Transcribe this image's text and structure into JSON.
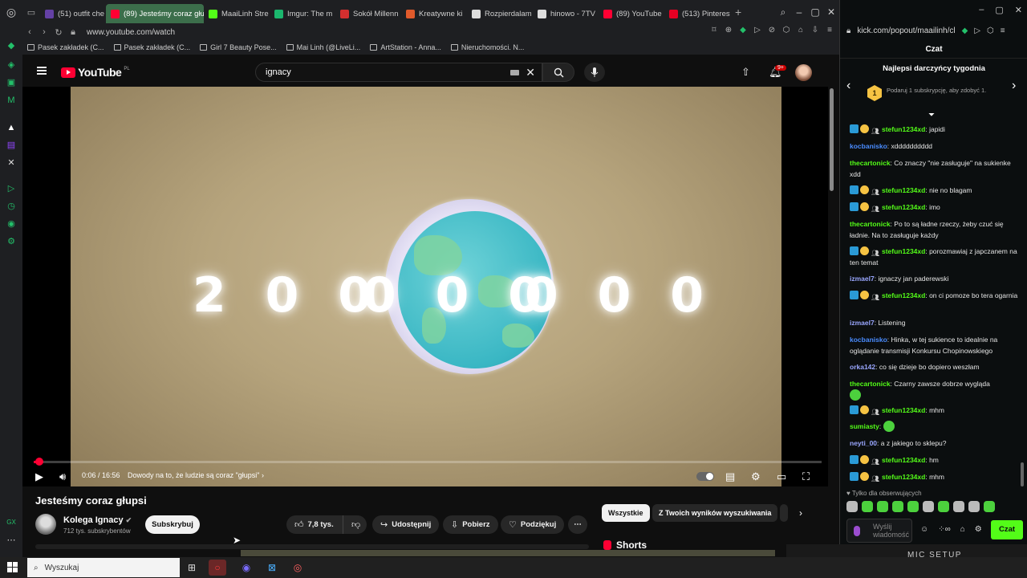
{
  "browser": {
    "tabs": [
      {
        "label": "(51) outfit che",
        "fav_color": "#6441a5"
      },
      {
        "label": "(89) Jesteśmy coraz głu",
        "fav_color": "#ff0033",
        "active": true
      },
      {
        "label": "MaaiLinh Stre",
        "fav_color": "#53fc18"
      },
      {
        "label": "Imgur: The m",
        "fav_color": "#1bb76e"
      },
      {
        "label": "Sokół Millenn",
        "fav_color": "#d32f2f"
      },
      {
        "label": "Kreatywne ki",
        "fav_color": "#e05a2b"
      },
      {
        "label": "Rozpierdalam",
        "fav_color": "#dddddd"
      },
      {
        "label": "hinowo - 7TV",
        "fav_color": "#dddddd"
      },
      {
        "label": "(89) YouTube",
        "fav_color": "#ff0033"
      },
      {
        "label": "(513) Pinterest",
        "fav_color": "#e60023"
      }
    ],
    "url": "www.youtube.com/watch",
    "bookmarks": [
      "Pasek zakładek (C...",
      "Pasek zakładek (C...",
      "Girl 7 Beauty Pose...",
      "Mai Linh (@LiveLi...",
      "ArtStation - Anna...",
      "Nieruchomości. N..."
    ]
  },
  "youtube": {
    "logo_text": "YouTube",
    "region": "PL",
    "search_value": "ignacy",
    "notif_count": "9+",
    "video": {
      "overlay_number": "200000000",
      "overlay_left": "2 0 0",
      "overlay_mid": "0 0 0",
      "overlay_right": "0 0 0",
      "progress": 0.006,
      "time": "0:06 / 16:56",
      "chapter": "Dowody na to, że ludzie są coraz \"głupsi\"  ›"
    },
    "title": "Jesteśmy coraz głupsi",
    "channel": {
      "name": "Kolega Ignacy",
      "subs": "712 tys. subskrybentów",
      "subscribe": "Subskrybuj"
    },
    "actions": {
      "likes": "7,8 tys.",
      "share": "Udostępnij",
      "download": "Pobierz",
      "thanks": "Podziękuj",
      "more": "⋯"
    },
    "chips": [
      "Wszystkie",
      "Z Twoich wyników wyszukiwania"
    ],
    "shorts": "Shorts"
  },
  "kick": {
    "url": "kick.com/popout/maailinh/cl",
    "title": "Czat",
    "top_title": "Najlepsi darczyńcy tygodnia",
    "gift_badge": "1",
    "gift_text": "Podaruj 1 subskrypcję, aby zdobyć 1.",
    "messages": [
      {
        "user": "stefun1234xd",
        "color": "#53fc18",
        "text": "japidi",
        "badges": true
      },
      {
        "user": "kocbanisko",
        "color": "#4a8cff",
        "text": "xdddddddddd",
        "badges": false
      },
      {
        "user": "thecartonick",
        "color": "#53fc18",
        "text": "Co znaczy \"nie zasługuje\" na sukienke xdd",
        "badges": false
      },
      {
        "user": "stefun1234xd",
        "color": "#53fc18",
        "text": "nie no blagam",
        "badges": true
      },
      {
        "user": "stefun1234xd",
        "color": "#53fc18",
        "text": "imo",
        "badges": true
      },
      {
        "user": "thecartonick",
        "color": "#53fc18",
        "text": "Po to są ładne rzeczy, żeby czuć się ładnie. Na to zasługuje każdy",
        "badges": false
      },
      {
        "user": "stefun1234xd",
        "color": "#53fc18",
        "text": "porozmawiaj z japczanem na ten temat",
        "badges": true
      },
      {
        "user": "izmael7",
        "color": "#9aa7ff",
        "text": "ignaczy jan paderewski",
        "badges": false
      },
      {
        "user": "stefun1234xd",
        "color": "#53fc18",
        "text": "on ci pomoze bo tera ogarnia",
        "badges": true
      },
      {
        "user": "izmael7",
        "color": "#9aa7ff",
        "text": "Listening",
        "badges": false
      },
      {
        "user": "kocbanisko",
        "color": "#4a8cff",
        "text": "Hinka, w tej sukience to idealnie na oglądanie transmisji Konkursu Chopinowskiego",
        "badges": false
      },
      {
        "user": "orka142",
        "color": "#9aa7ff",
        "text": "co się dzieje bo dopiero weszłam",
        "badges": false
      },
      {
        "user": "thecartonick",
        "color": "#53fc18",
        "text": "Czarny zawsze dobrze wygląda",
        "badges": false,
        "emote": true
      },
      {
        "user": "stefun1234xd",
        "color": "#53fc18",
        "text": "mhm",
        "badges": true
      },
      {
        "user": "sumiasty",
        "color": "#53fc18",
        "text": "",
        "badges": false,
        "emote_inline": true
      },
      {
        "user": "neyti_00",
        "color": "#9aa7ff",
        "text": "a z jakiego to sklepu?",
        "badges": false
      },
      {
        "user": "stefun1234xd",
        "color": "#53fc18",
        "text": "hm",
        "badges": true
      },
      {
        "user": "stefun1234xd",
        "color": "#53fc18",
        "text": "mhm",
        "badges": true
      }
    ],
    "followers_only": "♥ Tylko dla obserwujących",
    "input_placeholder": "Wyślij wiadomość",
    "send": "Czat",
    "mic_setup": "MIC SETUP"
  },
  "taskbar": {
    "search_placeholder": "Wyszukaj"
  }
}
